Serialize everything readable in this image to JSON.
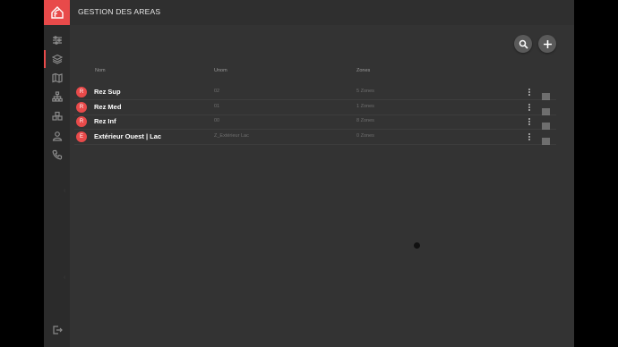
{
  "header": {
    "title": "GESTION DES AREAS"
  },
  "sidebar": {
    "logo_icon": "home-wifi-icon",
    "items": [
      {
        "icon": "settings-sliders-icon",
        "active": false
      },
      {
        "icon": "layers-icon",
        "active": true
      },
      {
        "icon": "map-icon",
        "active": false
      },
      {
        "icon": "hierarchy-icon",
        "active": false
      },
      {
        "icon": "groups-icon",
        "active": false
      },
      {
        "icon": "user-icon",
        "active": false
      },
      {
        "icon": "phone-icon",
        "active": false
      }
    ],
    "logout_icon": "logout-icon"
  },
  "toolbar": {
    "search_icon": "search-icon",
    "add_icon": "plus-icon"
  },
  "table": {
    "columns": {
      "nom": "Nom",
      "unom": "Unom",
      "zones": "Zones"
    },
    "rows": [
      {
        "badge": "R",
        "name": "Rez Sup",
        "unom": "02",
        "zones": "5 Zones"
      },
      {
        "badge": "R",
        "name": "Rez Med",
        "unom": "01",
        "zones": "1 Zones"
      },
      {
        "badge": "R",
        "name": "Rez Inf",
        "unom": "00",
        "zones": "8 Zones"
      },
      {
        "badge": "E",
        "name": "Extérieur Ouest | Lac",
        "unom": "Z_Extérieur Lac",
        "zones": "0 Zones"
      }
    ]
  },
  "colors": {
    "accent": "#e84a4a",
    "background": "#333333",
    "sidebar": "#2b2b2b"
  }
}
